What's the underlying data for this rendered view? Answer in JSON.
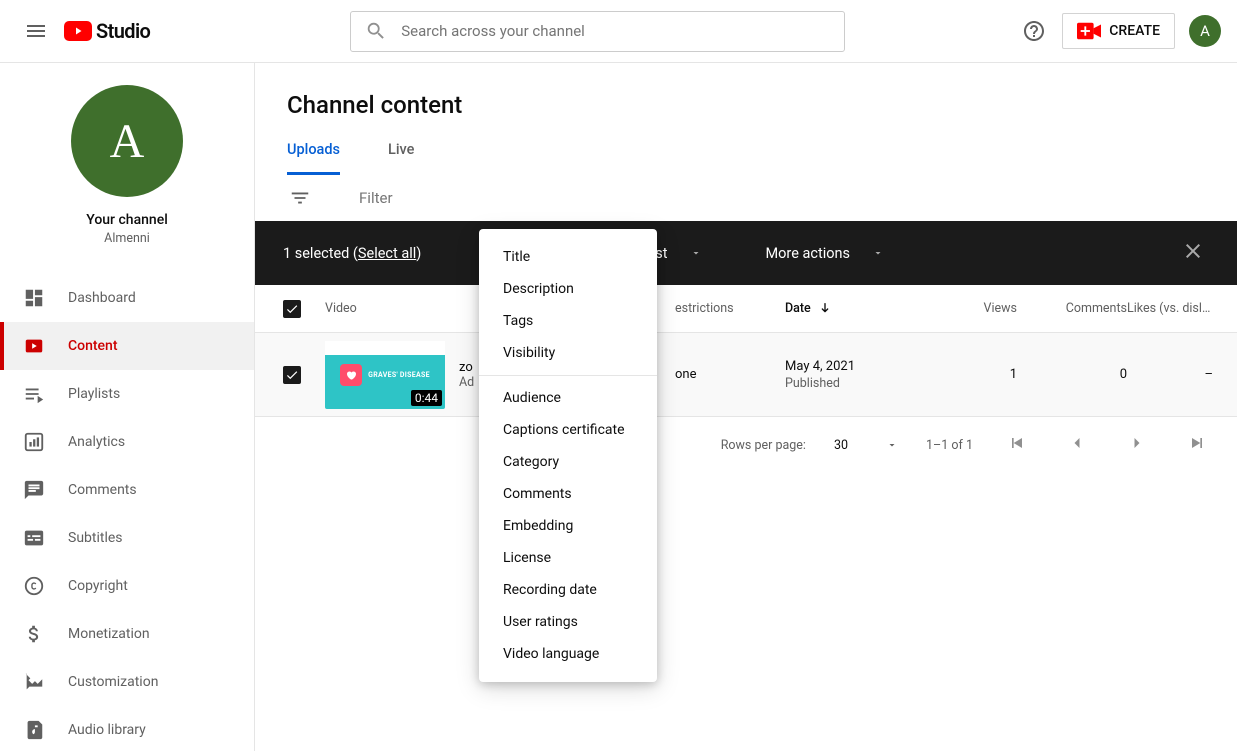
{
  "header": {
    "logo_text": "Studio",
    "search_placeholder": "Search across your channel",
    "create_label": "CREATE",
    "avatar_letter": "A"
  },
  "sidebar": {
    "avatar_letter": "A",
    "your_channel_label": "Your channel",
    "channel_name": "Almenni",
    "items": [
      {
        "label": "Dashboard"
      },
      {
        "label": "Content"
      },
      {
        "label": "Playlists"
      },
      {
        "label": "Analytics"
      },
      {
        "label": "Comments"
      },
      {
        "label": "Subtitles"
      },
      {
        "label": "Copyright"
      },
      {
        "label": "Monetization"
      },
      {
        "label": "Customization"
      },
      {
        "label": "Audio library"
      }
    ]
  },
  "page": {
    "title": "Channel content",
    "tabs": [
      {
        "label": "Uploads"
      },
      {
        "label": "Live"
      }
    ],
    "filter_placeholder": "Filter"
  },
  "selection_bar": {
    "count_text": "1 selected (",
    "select_all": "Select all",
    "count_suffix": ")",
    "edit_dd_visible": "ylist",
    "more_actions": "More actions"
  },
  "edit_menu": {
    "group1": [
      "Title",
      "Description",
      "Tags",
      "Visibility"
    ],
    "group2": [
      "Audience",
      "Captions certificate",
      "Category",
      "Comments",
      "Embedding",
      "License",
      "Recording date",
      "User ratings",
      "Video language"
    ]
  },
  "table": {
    "headers": {
      "video": "Video",
      "restrictions": "estrictions",
      "date": "Date",
      "views": "Views",
      "comments": "Comments",
      "likes": "Likes (vs. dislike…"
    },
    "row": {
      "title_prefix": "zo",
      "subtitle_prefix": "Ad",
      "thumb_text": "GRAVES' DISEASE",
      "duration": "0:44",
      "restrictions": "one",
      "date": "May 4, 2021",
      "date_status": "Published",
      "views": "1",
      "comments": "0",
      "likes": "–"
    }
  },
  "pager": {
    "rows_label": "Rows per page:",
    "rows_value": "30",
    "range": "1–1 of 1"
  }
}
